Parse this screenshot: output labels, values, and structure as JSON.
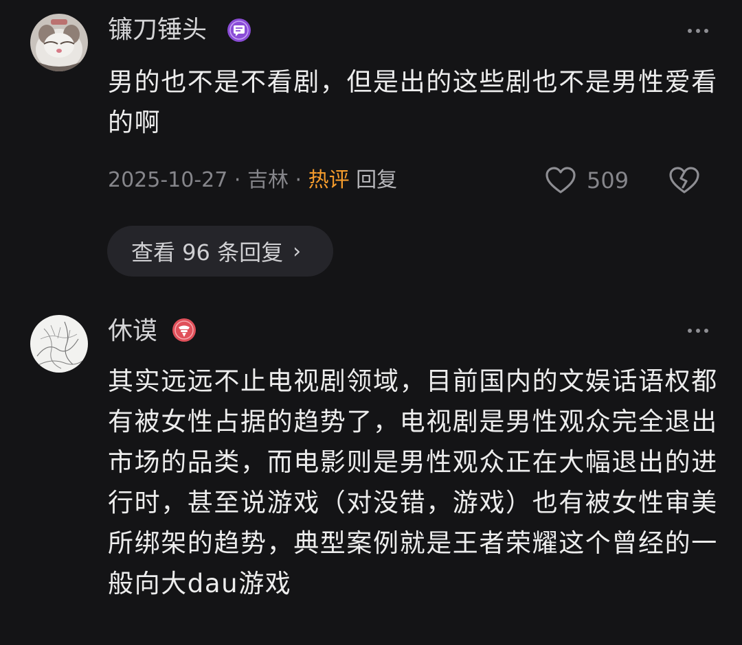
{
  "comments": [
    {
      "username": "镰刀锤头",
      "badge_icon": "chat-bubble-badge-icon",
      "badge_color": "#8a4cd6",
      "text": "男的也不是不看剧，但是出的这些剧也不是男性爱看的啊",
      "date": "2025-10-27",
      "location": "吉林",
      "hot_label": "热评",
      "reply_label": "回复",
      "likes": "509",
      "view_replies_label": "查看 96 条回复",
      "view_replies_chevron": "›"
    },
    {
      "username": "休谟",
      "badge_icon": "microphone-badge-icon",
      "badge_color": "#e0505a",
      "text": "其实远远不止电视剧领域，目前国内的文娱话语权都有被女性占据的趋势了，电视剧是男性观众完全退出市场的品类，而电影则是男性观众正在大幅退出的进行时，甚至说游戏（对没错，游戏）也有被女性审美所绑架的趋势，典型案例就是王者荣耀这个曾经的一般向大dau游戏"
    }
  ],
  "meta_separator": " · ",
  "colors": {
    "background": "#141416",
    "hot_label": "#f49b2c",
    "secondary_text": "#86868b",
    "pill_background": "#25252a"
  }
}
